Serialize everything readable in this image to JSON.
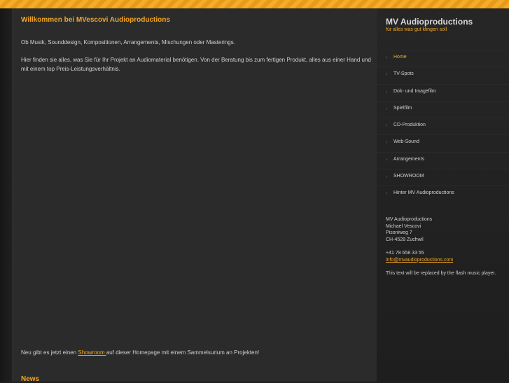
{
  "main": {
    "title": "Willkommen bei MVescovi Audioproductions",
    "intro": "Ob Musik, Sounddesign, Kompositionen, Arrangements, Mischungen oder Masterings.",
    "description": "Hier finden sie alles, was Sie für Ihr Projekt an Audiomaterial benötigen. Von der Beratung bis  zum fertigen Produkt, alles aus einer Hand und mit einem top Preis-Leistungsverhältnis.",
    "showroom_prefix": "Neu gibt es jetzt einen ",
    "showroom_link": "Showroom ",
    "showroom_suffix": "auf dieser Homepage mit einem Sammelsurium an Projekten!",
    "news_title": "News"
  },
  "sidebar": {
    "site_title": "MV Audioproductions",
    "site_subtitle": "für alles was gut klingen soll",
    "nav": [
      {
        "label": "Home",
        "active": true
      },
      {
        "label": "TV-Spots"
      },
      {
        "label": "Dok- und Imagefilm"
      },
      {
        "label": "Spielfilm"
      },
      {
        "label": "CD-Produktion"
      },
      {
        "label": "Web-Sound"
      },
      {
        "label": "Arrangements"
      },
      {
        "label": "SHOWROOM"
      },
      {
        "label": "Hinter MV Audioproductions"
      }
    ],
    "contact": {
      "company": "MV Audioproductions",
      "name": "Michael Vescovi",
      "street": "Pisoniweg 7",
      "city": "CH-4528 Zuchwil",
      "phone": "+41 78 658 33 55",
      "email": "info@mvaudioproductions.com"
    },
    "flash_text": "This text will be replaced by the flash music player."
  },
  "icons": {
    "nav_bullet": "chevron-right-icon"
  },
  "colors": {
    "accent": "#f2a623",
    "stripe": "#f3ac2c",
    "content_bg": "#2b2b2b",
    "page_bg": "#1f1f1f"
  }
}
